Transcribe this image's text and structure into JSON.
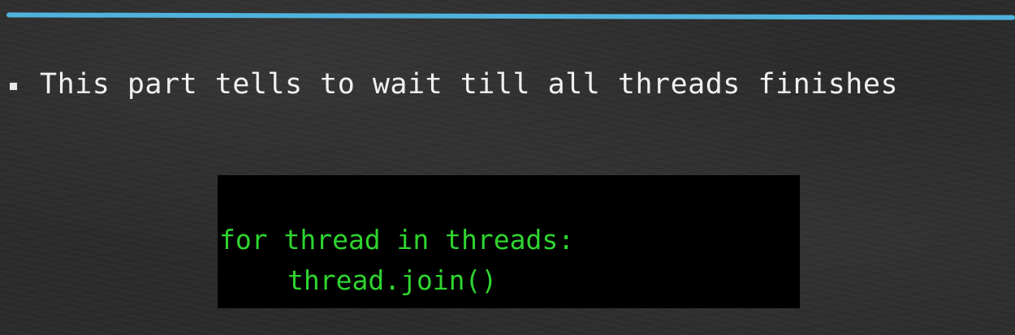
{
  "slide": {
    "bullet": {
      "text": "This part tells to wait till all threads finishes"
    },
    "code": {
      "lines": [
        "for thread in threads:",
        "thread.join()"
      ]
    }
  },
  "colors": {
    "accent_rule": "#4fb3dd",
    "code_text": "#2fd52f",
    "code_background": "#000000",
    "body_text": "#f0f0f0"
  }
}
